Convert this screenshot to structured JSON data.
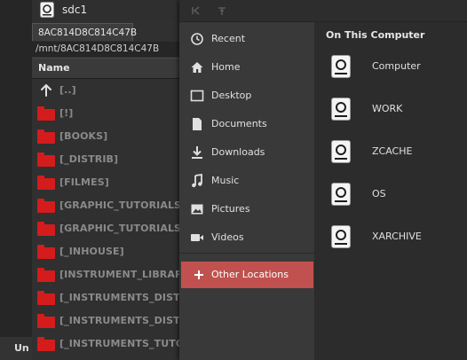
{
  "file_manager": {
    "drive_label": "sdc1",
    "path_tab": "8AC814D8C814C47B",
    "path": "/mnt/8AC814D8C814C47B",
    "column_name": "Name",
    "status_text": "Un",
    "parent_entry": "[..]",
    "folders": [
      "[!]",
      "[BOOKS]",
      "[_DISTRIB]",
      "[FILMES]",
      "[GRAPHIC_TUTORIALS]",
      "[GRAPHIC_TUTORIALS_NO",
      "[_INHOUSE]",
      "[INSTRUMENT_LIBRARY]",
      "[_INSTRUMENTS_DISTRIB_",
      "[_INSTRUMENTS_DISTRIB_",
      "[_INSTRUMENTS_TUTORIA"
    ],
    "folder_color": "#d41c1c"
  },
  "dialog": {
    "places": [
      {
        "label": "Recent",
        "icon": "clock-icon"
      },
      {
        "label": "Home",
        "icon": "home-icon"
      },
      {
        "label": "Desktop",
        "icon": "desktop-icon"
      },
      {
        "label": "Documents",
        "icon": "document-icon"
      },
      {
        "label": "Downloads",
        "icon": "download-icon"
      },
      {
        "label": "Music",
        "icon": "music-icon"
      },
      {
        "label": "Pictures",
        "icon": "picture-icon"
      },
      {
        "label": "Videos",
        "icon": "video-icon"
      }
    ],
    "other_locations": "Other Locations",
    "accent_color": "#c0514e",
    "section_title": "On This Computer",
    "locations": [
      {
        "label": "Computer"
      },
      {
        "label": "WORK"
      },
      {
        "label": "ZCACHE"
      },
      {
        "label": "OS"
      },
      {
        "label": "XARCHIVE"
      }
    ]
  }
}
